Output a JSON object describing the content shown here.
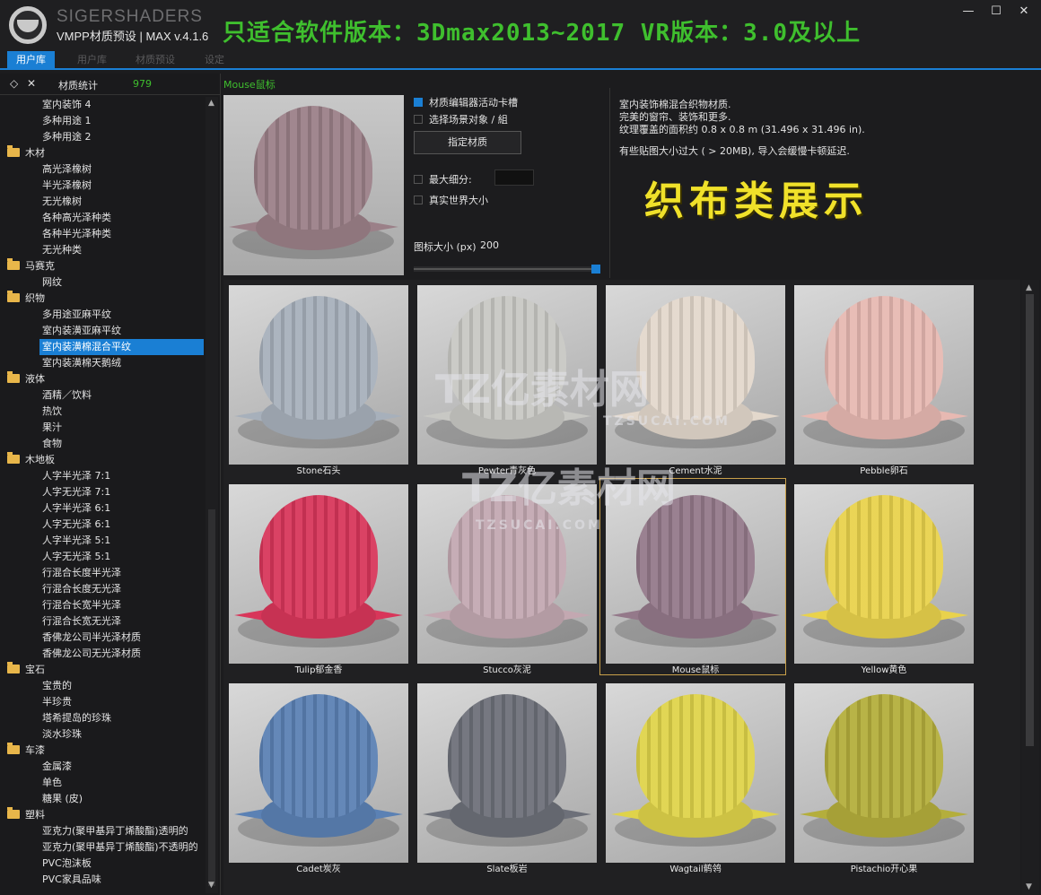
{
  "window": {
    "brand": "SIGERSHADERS",
    "subtitle": "VMPP材质预设 | MAX v.4.1.6",
    "banner": "只适合软件版本：3Dmax2013~2017  VR版本：3.0及以上",
    "minimize": "—",
    "maximize": "☐",
    "close": "✕"
  },
  "tabs": [
    "用户库",
    "用户库",
    "材质预设",
    "设定"
  ],
  "left": {
    "collapse_icon": "◇",
    "close_icon": "✕",
    "stats_label": "材质统计",
    "stats_count": "979"
  },
  "tree": [
    {
      "type": "child",
      "label": "室内装饰 4"
    },
    {
      "type": "child",
      "label": "多种用途 1"
    },
    {
      "type": "child",
      "label": "多种用途 2"
    },
    {
      "type": "folder",
      "label": "木材"
    },
    {
      "type": "child",
      "label": "高光泽橡树"
    },
    {
      "type": "child",
      "label": "半光泽橡树"
    },
    {
      "type": "child",
      "label": "无光橡树"
    },
    {
      "type": "child",
      "label": "各种高光泽种类"
    },
    {
      "type": "child",
      "label": "各种半光泽种类"
    },
    {
      "type": "child",
      "label": "无光种类"
    },
    {
      "type": "folder",
      "label": "马赛克"
    },
    {
      "type": "child",
      "label": "网纹"
    },
    {
      "type": "folder",
      "label": "织物"
    },
    {
      "type": "child",
      "label": "多用途亚麻平纹"
    },
    {
      "type": "child",
      "label": "室内装潢亚麻平纹"
    },
    {
      "type": "child",
      "label": "室内装潢棉混合平纹",
      "selected": true
    },
    {
      "type": "child",
      "label": "室内装潢棉天鹅绒"
    },
    {
      "type": "folder",
      "label": "液体"
    },
    {
      "type": "child",
      "label": "酒精／饮料"
    },
    {
      "type": "child",
      "label": "热饮"
    },
    {
      "type": "child",
      "label": "果汁"
    },
    {
      "type": "child",
      "label": "食物"
    },
    {
      "type": "folder",
      "label": "木地板"
    },
    {
      "type": "child",
      "label": "人字半光泽 7:1"
    },
    {
      "type": "child",
      "label": "人字无光泽 7:1"
    },
    {
      "type": "child",
      "label": "人字半光泽 6:1"
    },
    {
      "type": "child",
      "label": "人字无光泽 6:1"
    },
    {
      "type": "child",
      "label": "人字半光泽 5:1"
    },
    {
      "type": "child",
      "label": "人字无光泽 5:1"
    },
    {
      "type": "child",
      "label": "行混合长度半光泽"
    },
    {
      "type": "child",
      "label": "行混合长度无光泽"
    },
    {
      "type": "child",
      "label": "行混合长宽半光泽"
    },
    {
      "type": "child",
      "label": "行混合长宽无光泽"
    },
    {
      "type": "child",
      "label": "香佛龙公司半光泽材质"
    },
    {
      "type": "child",
      "label": "香佛龙公司无光泽材质"
    },
    {
      "type": "folder",
      "label": "宝石"
    },
    {
      "type": "child",
      "label": "宝贵的"
    },
    {
      "type": "child",
      "label": "半珍贵"
    },
    {
      "type": "child",
      "label": "塔希提岛的珍珠"
    },
    {
      "type": "child",
      "label": "淡水珍珠"
    },
    {
      "type": "folder",
      "label": "车漆"
    },
    {
      "type": "child",
      "label": "金属漆"
    },
    {
      "type": "child",
      "label": "单色"
    },
    {
      "type": "child",
      "label": "糖果 (皮)"
    },
    {
      "type": "folder",
      "label": "塑料"
    },
    {
      "type": "child",
      "label": "亚克力(聚甲基异丁烯酸酯)透明的"
    },
    {
      "type": "child",
      "label": "亚克力(聚甲基异丁烯酸酯)不透明的"
    },
    {
      "type": "child",
      "label": "PVC泡沫板"
    },
    {
      "type": "child",
      "label": "PVC家具品味"
    }
  ],
  "preview": {
    "title": "Mouse鼠标",
    "color": "#9b8088",
    "opt_activeslot": "材质编辑器活动卡槽",
    "opt_selectscene": "选择场景对象 / 組",
    "assign_button": "指定材质",
    "opt_maxsubdiv": "最大细分:",
    "opt_realworld": "真实世界大小",
    "icon_size_label": "图标大小 (px)",
    "icon_size_value": "200",
    "icon_size_fraction": 1.0
  },
  "info": {
    "line1": "室内装饰棉混合织物材质.",
    "line2": "完美的窗帘、装饰和更多.",
    "line3": "纹理覆盖的面积约 0.8 x 0.8 m (31.496 x 31.496 in).",
    "line4": "有些贴图大小过大 ( > 20MB), 导入会缓慢卡顿延迟.",
    "showcase": "织布类展示"
  },
  "watermark": {
    "text": "TZ亿素材网",
    "url": "TZSUCAI.COM"
  },
  "materials": [
    {
      "name": "Stone石头",
      "color": "#a7b0bb"
    },
    {
      "name": "Pewter青灰色",
      "color": "#c8c8c4"
    },
    {
      "name": "Cement水泥",
      "color": "#e3d8cc"
    },
    {
      "name": "Pebble卵石",
      "color": "#e7b9b2"
    },
    {
      "name": "Tulip郁金香",
      "color": "#d8365a"
    },
    {
      "name": "Stucco灰泥",
      "color": "#c3a8b1"
    },
    {
      "name": "Mouse鼠标",
      "color": "#94798a",
      "selected": true
    },
    {
      "name": "Yellow黄色",
      "color": "#e9d24c"
    },
    {
      "name": "Cadet炭灰",
      "color": "#5b81b4"
    },
    {
      "name": "Slate板岩",
      "color": "#6d7079"
    },
    {
      "name": "Wagtail鹡鸰",
      "color": "#dfd34a"
    },
    {
      "name": "Pistachio开心果",
      "color": "#b4ae3c"
    }
  ]
}
